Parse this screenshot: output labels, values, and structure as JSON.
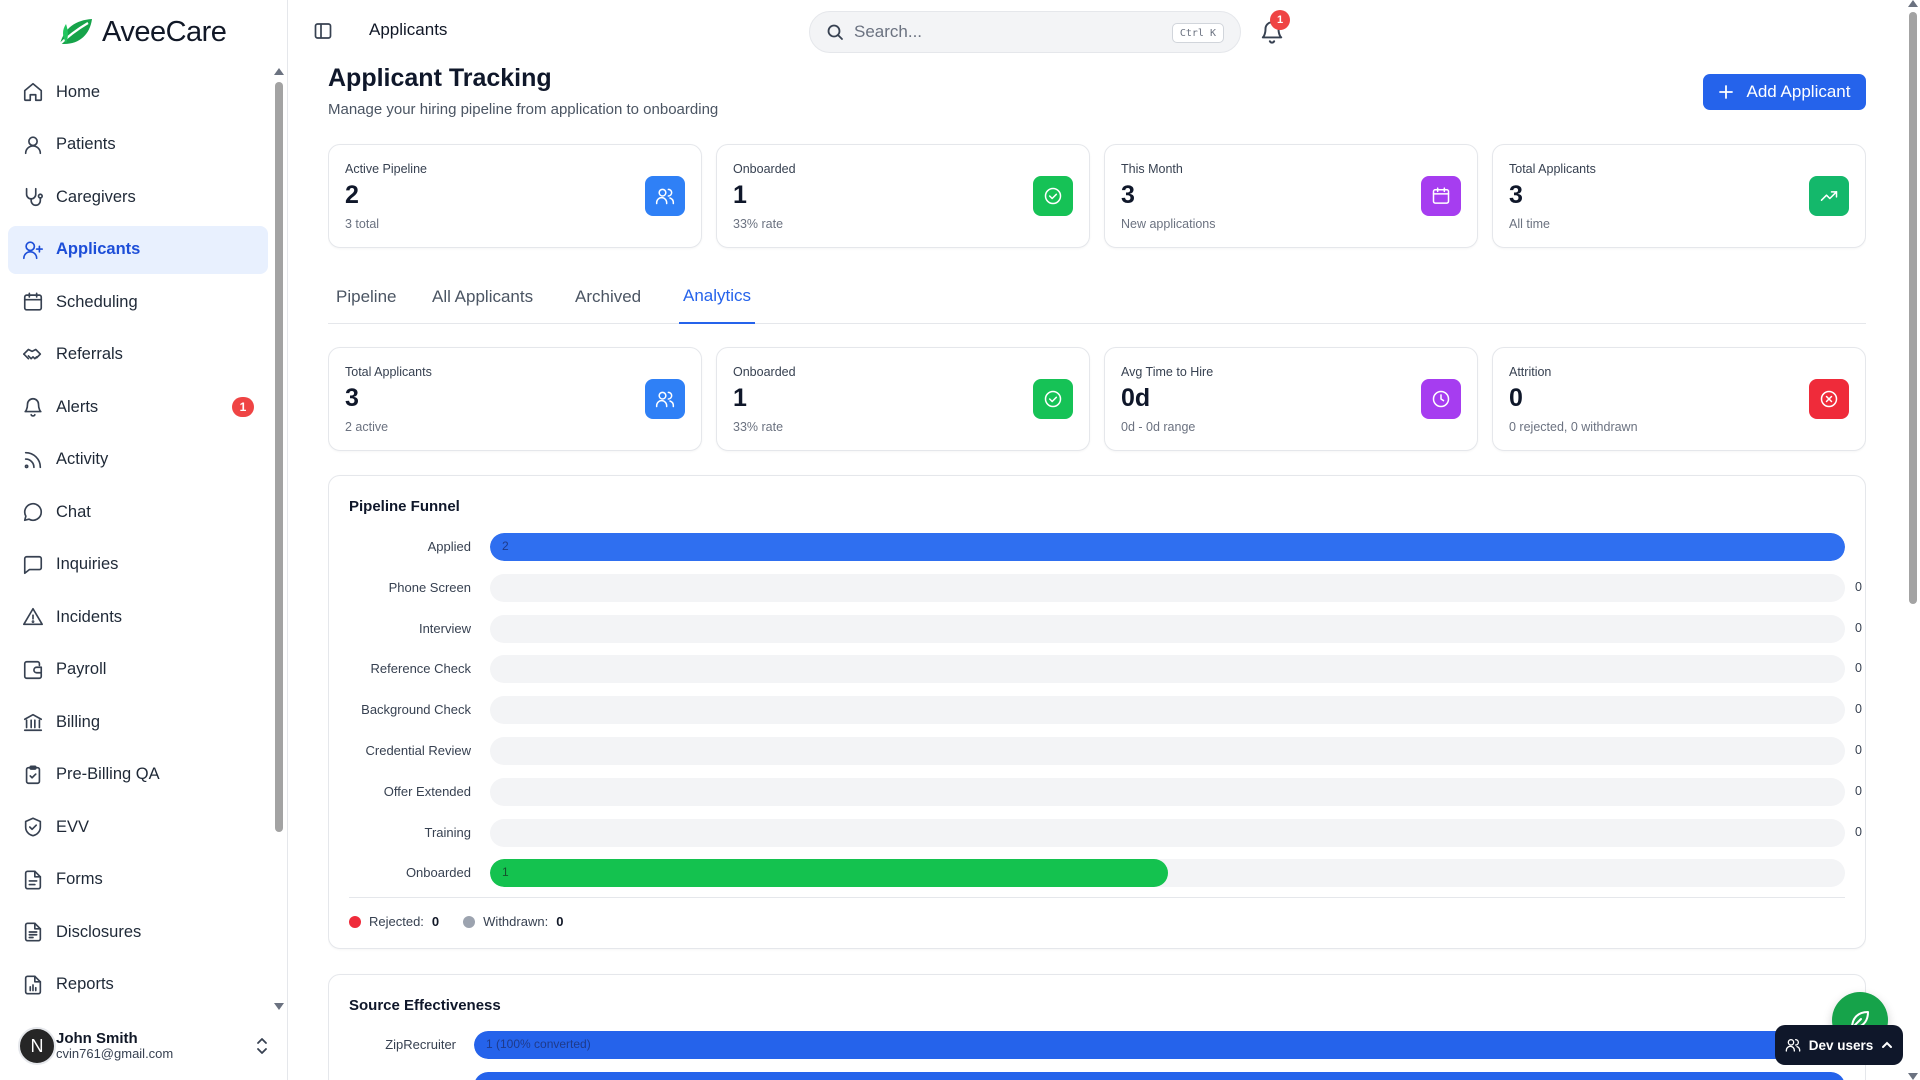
{
  "app": {
    "name": "AveeCare"
  },
  "sidebar": {
    "items": [
      {
        "label": "Home",
        "icon": "home-icon"
      },
      {
        "label": "Patients",
        "icon": "user-icon"
      },
      {
        "label": "Caregivers",
        "icon": "stethoscope-icon"
      },
      {
        "label": "Applicants",
        "icon": "user-plus-icon",
        "active": true
      },
      {
        "label": "Scheduling",
        "icon": "calendar-icon"
      },
      {
        "label": "Referrals",
        "icon": "handshake-icon"
      },
      {
        "label": "Alerts",
        "icon": "bell-icon",
        "badge": "1"
      },
      {
        "label": "Activity",
        "icon": "rss-icon"
      },
      {
        "label": "Chat",
        "icon": "chat-bubble-icon"
      },
      {
        "label": "Inquiries",
        "icon": "message-square-icon"
      },
      {
        "label": "Incidents",
        "icon": "warning-triangle-icon"
      },
      {
        "label": "Payroll",
        "icon": "wallet-icon"
      },
      {
        "label": "Billing",
        "icon": "bank-icon"
      },
      {
        "label": "Pre-Billing QA",
        "icon": "clipboard-check-icon"
      },
      {
        "label": "EVV",
        "icon": "shield-check-icon"
      },
      {
        "label": "Forms",
        "icon": "file-text-icon"
      },
      {
        "label": "Disclosures",
        "icon": "file-lines-icon"
      },
      {
        "label": "Reports",
        "icon": "file-chart-icon"
      }
    ]
  },
  "user": {
    "initial": "N",
    "name": "John Smith",
    "email": "cvin761@gmail.com"
  },
  "topbar": {
    "page": "Applicants",
    "search_placeholder": "Search...",
    "search_shortcut": "Ctrl K",
    "notifications": "1"
  },
  "header": {
    "title": "Applicant Tracking",
    "subtitle": "Manage your hiring pipeline from application to onboarding",
    "add_label": "Add Applicant"
  },
  "top_stats": [
    {
      "label": "Active Pipeline",
      "value": "2",
      "sub": "3 total",
      "icon": "users-icon",
      "color": "#2f80f6"
    },
    {
      "label": "Onboarded",
      "value": "1",
      "sub": "33% rate",
      "icon": "check-circle-icon",
      "color": "#16c256"
    },
    {
      "label": "This Month",
      "value": "3",
      "sub": "New applications",
      "icon": "calendar-icon",
      "color": "#a63df0"
    },
    {
      "label": "Total Applicants",
      "value": "3",
      "sub": "All time",
      "icon": "trending-up-icon",
      "color": "#14b86b"
    }
  ],
  "tabs": [
    "Pipeline",
    "All Applicants",
    "Archived",
    "Analytics"
  ],
  "active_tab": "Analytics",
  "analytics_stats": [
    {
      "label": "Total Applicants",
      "value": "3",
      "sub": "2 active",
      "icon": "users-icon",
      "color": "#2f80f6"
    },
    {
      "label": "Onboarded",
      "value": "1",
      "sub": "33% rate",
      "icon": "check-circle-icon",
      "color": "#16c256"
    },
    {
      "label": "Avg Time to Hire",
      "value": "0d",
      "sub": "0d - 0d range",
      "icon": "clock-icon",
      "color": "#a63df0"
    },
    {
      "label": "Attrition",
      "value": "0",
      "sub": "0 rejected, 0 withdrawn",
      "icon": "x-circle-icon",
      "color": "#ef2b3a"
    }
  ],
  "funnel": {
    "title": "Pipeline Funnel",
    "max": 2,
    "stages": [
      {
        "label": "Applied",
        "value": 2,
        "display": "2",
        "color": "#2f6ff0"
      },
      {
        "label": "Phone Screen",
        "value": 0,
        "display": "0",
        "color": "#2f6ff0"
      },
      {
        "label": "Interview",
        "value": 0,
        "display": "0",
        "color": "#2f6ff0"
      },
      {
        "label": "Reference Check",
        "value": 0,
        "display": "0",
        "color": "#2f6ff0"
      },
      {
        "label": "Background Check",
        "value": 0,
        "display": "0",
        "color": "#2f6ff0"
      },
      {
        "label": "Credential Review",
        "value": 0,
        "display": "0",
        "color": "#2f6ff0"
      },
      {
        "label": "Offer Extended",
        "value": 0,
        "display": "0",
        "color": "#2f6ff0"
      },
      {
        "label": "Training",
        "value": 0,
        "display": "0",
        "color": "#2f6ff0"
      },
      {
        "label": "Onboarded",
        "value": 1,
        "display": "1",
        "color": "#14c24f"
      }
    ],
    "legend": [
      {
        "label": "Rejected:",
        "value": "0",
        "color": "#ef2b3a"
      },
      {
        "label": "Withdrawn:",
        "value": "0",
        "color": "#9ca3af"
      }
    ]
  },
  "sources": {
    "title": "Source Effectiveness",
    "items": [
      {
        "label": "ZipRecruiter",
        "fraction": 1,
        "text": "1 (100% converted)"
      },
      {
        "label": "",
        "fraction": 1,
        "text": ""
      }
    ]
  },
  "floating": {
    "dev_users_label": "Dev users"
  }
}
